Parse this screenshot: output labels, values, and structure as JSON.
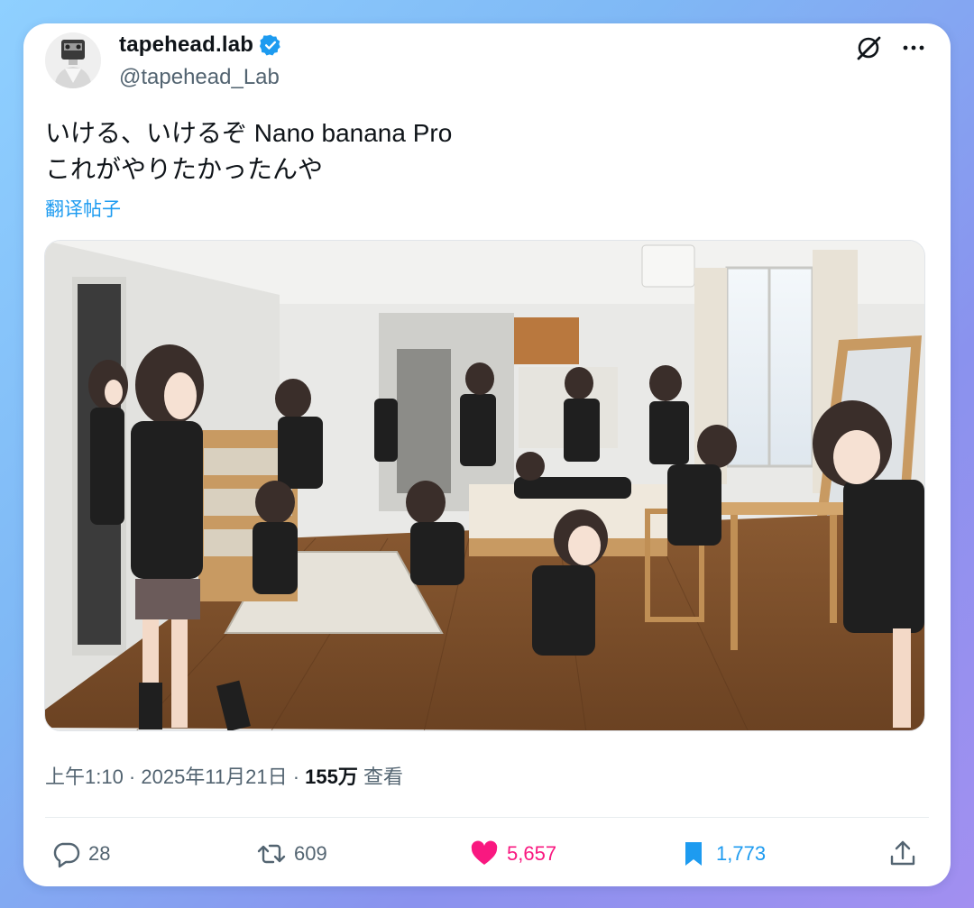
{
  "user": {
    "display_name": "tapehead.lab",
    "handle": "@tapehead_Lab",
    "verified": true
  },
  "tweet": {
    "lines": [
      "いける、いけるぞ Nano banana Pro",
      "これがやりたかったんや"
    ],
    "translate_label": "翻译帖子"
  },
  "meta": {
    "timestamp": "上午1:10 · 2025年11月21日 · ",
    "views": "155万",
    "views_label": " 查看"
  },
  "actions": {
    "replies": "28",
    "retweets": "609",
    "likes": "5,657",
    "bookmarks": "1,773"
  },
  "icons": {
    "grok": "grok-slash-icon",
    "more": "more-dots-icon",
    "reply": "reply-bubble-icon",
    "retweet": "retweet-icon",
    "like": "heart-icon",
    "bookmark": "bookmark-icon",
    "share": "share-upload-icon"
  },
  "colors": {
    "like": "#f91880",
    "bookmark": "#1d9bf0",
    "verified": "#1d9bf0",
    "text": "#0f1419",
    "secondary": "#536471"
  }
}
